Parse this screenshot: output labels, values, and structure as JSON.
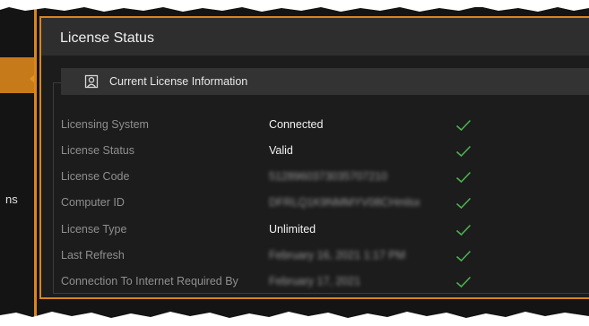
{
  "sidebar": {
    "partial_label": "ns"
  },
  "panel": {
    "title": "License Status",
    "group_title": "Current License Information"
  },
  "rows": [
    {
      "label": "Licensing System",
      "value": "Connected",
      "status": "check-icon"
    },
    {
      "label": "License Status",
      "value": "Valid",
      "status": "check-icon"
    },
    {
      "label": "License Code",
      "value": "5128960373035707210",
      "status": "check-icon"
    },
    {
      "label": "Computer ID",
      "value": "DFRLQ1K9NMMYV08CHmlsx",
      "status": "check-icon"
    },
    {
      "label": "License Type",
      "value": "Unlimited",
      "status": "check-icon"
    },
    {
      "label": "Last Refresh",
      "value": "February 16, 2021 1:17 PM",
      "status": "check-icon"
    },
    {
      "label": "Connection To Internet Required By",
      "value": "February 17, 2021",
      "status": "check-icon"
    }
  ],
  "colors": {
    "accent": "#d9861e",
    "check": "#4caf50",
    "background": "#141414"
  }
}
